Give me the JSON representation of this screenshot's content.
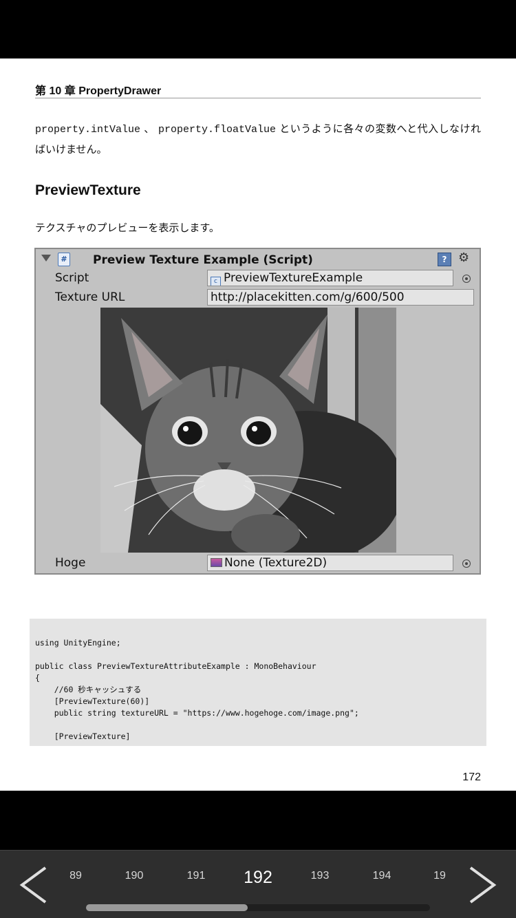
{
  "page": {
    "chapter_prefix": "第",
    "chapter_number": "10",
    "chapter_suffix": "章",
    "chapter_title": "PropertyDrawer",
    "para1_code1": "property.intValue",
    "para1_sep": " 、",
    "para1_code2": "property.floatValue",
    "para1_text": " というように各々の変数へと代入しなければいけません。",
    "section_title": "PreviewTexture",
    "para2": "テクスチャのプレビューを表示します。",
    "page_number": "172"
  },
  "inspector": {
    "title": "Preview Texture Example (Script)",
    "script_label": "Script",
    "script_value": "PreviewTextureExample",
    "texture_url_label": "Texture URL",
    "texture_url_value": "http://placekitten.com/g/600/500",
    "hoge_label": "Hoge",
    "hoge_value": "None (Texture2D)",
    "script_icon": "csharp-script-icon",
    "help_icon": "help-book-icon",
    "gear_icon": "gear-icon"
  },
  "code": {
    "lines": [
      "using UnityEngine;",
      "",
      "public class PreviewTextureAttributeExample : MonoBehaviour",
      "{",
      "    //60 秒キャッシュする",
      "    [PreviewTexture(60)]",
      "    public string textureURL = \"https://www.hogehoge.com/image.png\";",
      "",
      "    [PreviewTexture]"
    ]
  },
  "nav": {
    "pages": [
      "89",
      "190",
      "191",
      "192",
      "193",
      "194",
      "19"
    ],
    "current": "192",
    "scroll_fraction": 0.47
  }
}
